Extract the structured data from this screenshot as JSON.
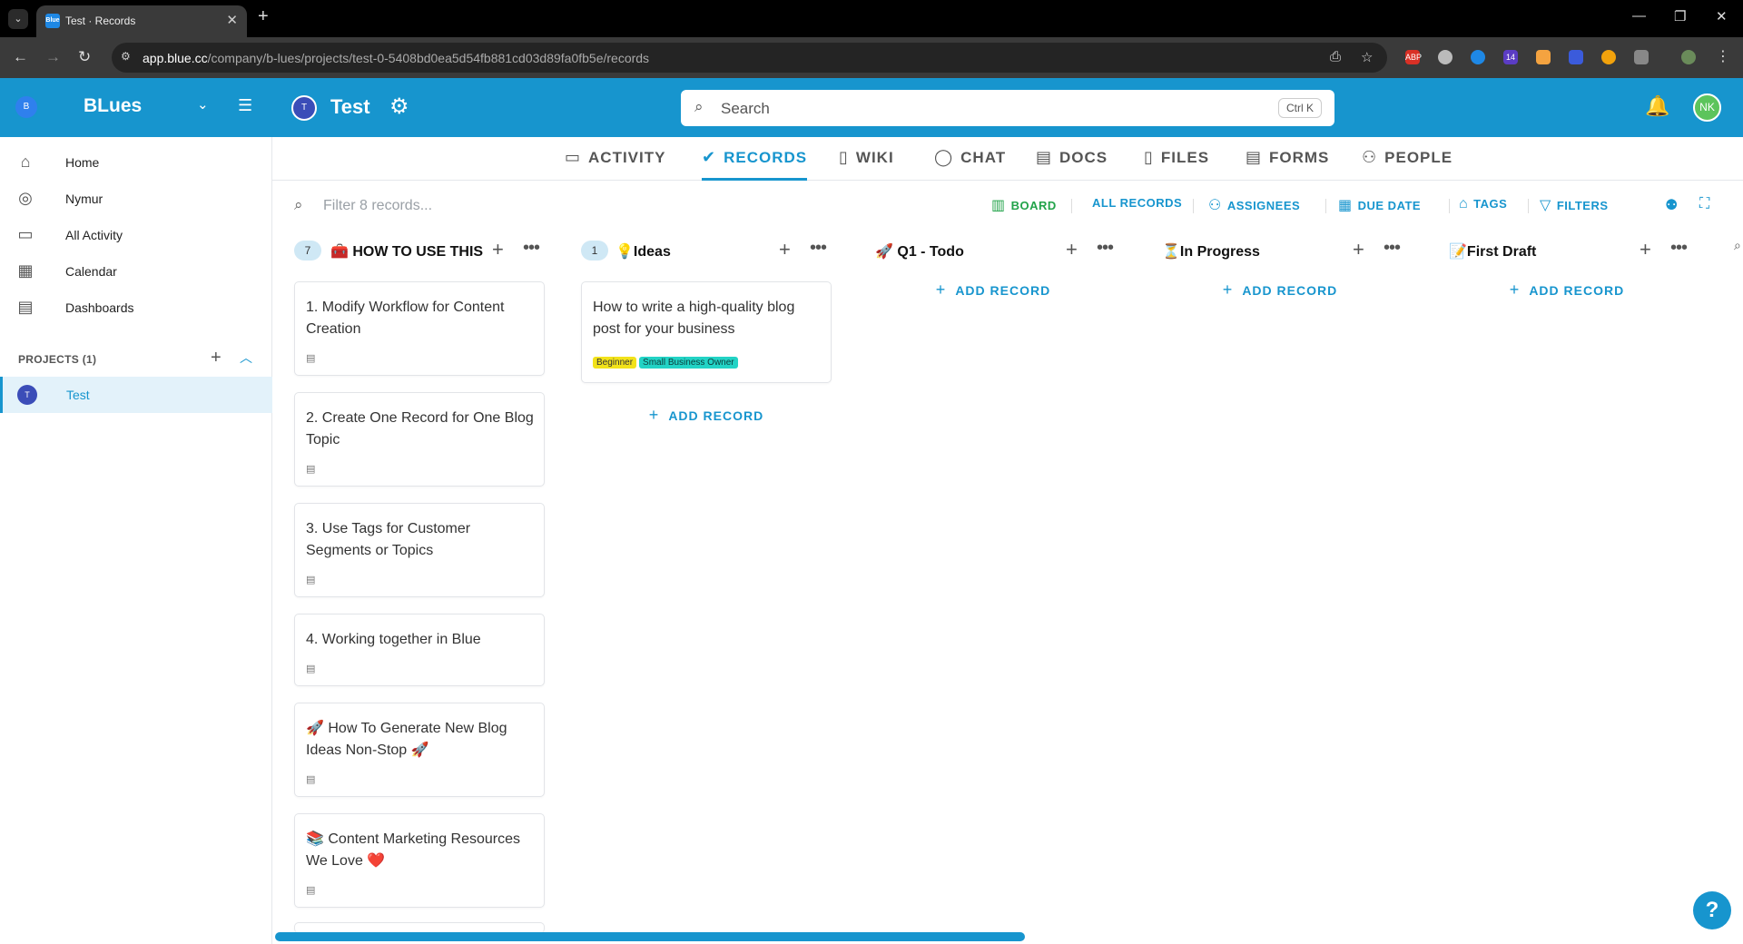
{
  "browser": {
    "tab_title": "Test · Records",
    "url_host": "app.blue.cc",
    "url_path": "/company/b-lues/projects/test-0-5408bd0ea5d54fb881cd03d89fa0fb5e/records",
    "extensions": [
      "ABP",
      "",
      "",
      "14",
      "",
      "",
      "",
      "",
      ""
    ]
  },
  "header": {
    "workspace_initial": "B",
    "workspace_name": "BLues",
    "project_initial": "T",
    "project_name": "Test",
    "search_placeholder": "Search",
    "search_shortcut": "Ctrl K",
    "user_initials": "NK"
  },
  "sidebar": {
    "items": [
      {
        "label": "Home",
        "icon": "home-icon"
      },
      {
        "label": "Nymur",
        "icon": "check-circle-icon"
      },
      {
        "label": "All Activity",
        "icon": "activity-icon"
      },
      {
        "label": "Calendar",
        "icon": "calendar-icon"
      },
      {
        "label": "Dashboards",
        "icon": "dashboard-icon"
      }
    ],
    "projects_header": "PROJECTS (1)",
    "projects": [
      {
        "initial": "T",
        "label": "Test"
      }
    ]
  },
  "tabs": [
    {
      "label": "ACTIVITY",
      "icon": "activity-icon"
    },
    {
      "label": "RECORDS",
      "icon": "check-circle-icon",
      "active": true
    },
    {
      "label": "WIKI",
      "icon": "document-icon"
    },
    {
      "label": "CHAT",
      "icon": "chat-icon"
    },
    {
      "label": "DOCS",
      "icon": "docs-icon"
    },
    {
      "label": "FILES",
      "icon": "file-icon"
    },
    {
      "label": "FORMS",
      "icon": "form-icon"
    },
    {
      "label": "PEOPLE",
      "icon": "people-icon"
    }
  ],
  "toolbar": {
    "filter_placeholder": "Filter 8 records...",
    "board": "BOARD",
    "all_records": "ALL RECORDS",
    "assignees": "ASSIGNEES",
    "due_date": "DUE DATE",
    "tags": "TAGS",
    "filters": "FILTERS"
  },
  "board": {
    "add_record_label": "ADD RECORD",
    "columns": [
      {
        "count": "7",
        "title": "🧰 HOW TO USE THIS",
        "cards": [
          {
            "title": "1. Modify Workflow for Content Creation"
          },
          {
            "title": "2. Create One Record for One Blog Topic"
          },
          {
            "title": "3. Use Tags for Customer Segments or Topics"
          },
          {
            "title": "4. Working together in Blue"
          },
          {
            "title": "🚀 How To Generate New Blog Ideas Non-Stop 🚀"
          },
          {
            "title": "📚 Content Marketing Resources We Love ❤️"
          }
        ]
      },
      {
        "count": "1",
        "title": "💡Ideas",
        "cards": [
          {
            "title": "How to write a high-quality blog post for your business",
            "tags": [
              "Beginner",
              "Small Business Owner"
            ]
          }
        ]
      },
      {
        "count": "",
        "title": "🚀 Q1 - Todo",
        "cards": []
      },
      {
        "count": "",
        "title": "⏳In Progress",
        "cards": []
      },
      {
        "count": "",
        "title": "📝First Draft",
        "cards": []
      }
    ]
  },
  "colors": {
    "brand": "#1795ce",
    "tag_beginner": "#f2e21a",
    "tag_smb": "#22d3c5",
    "board_green": "#22a34a"
  }
}
